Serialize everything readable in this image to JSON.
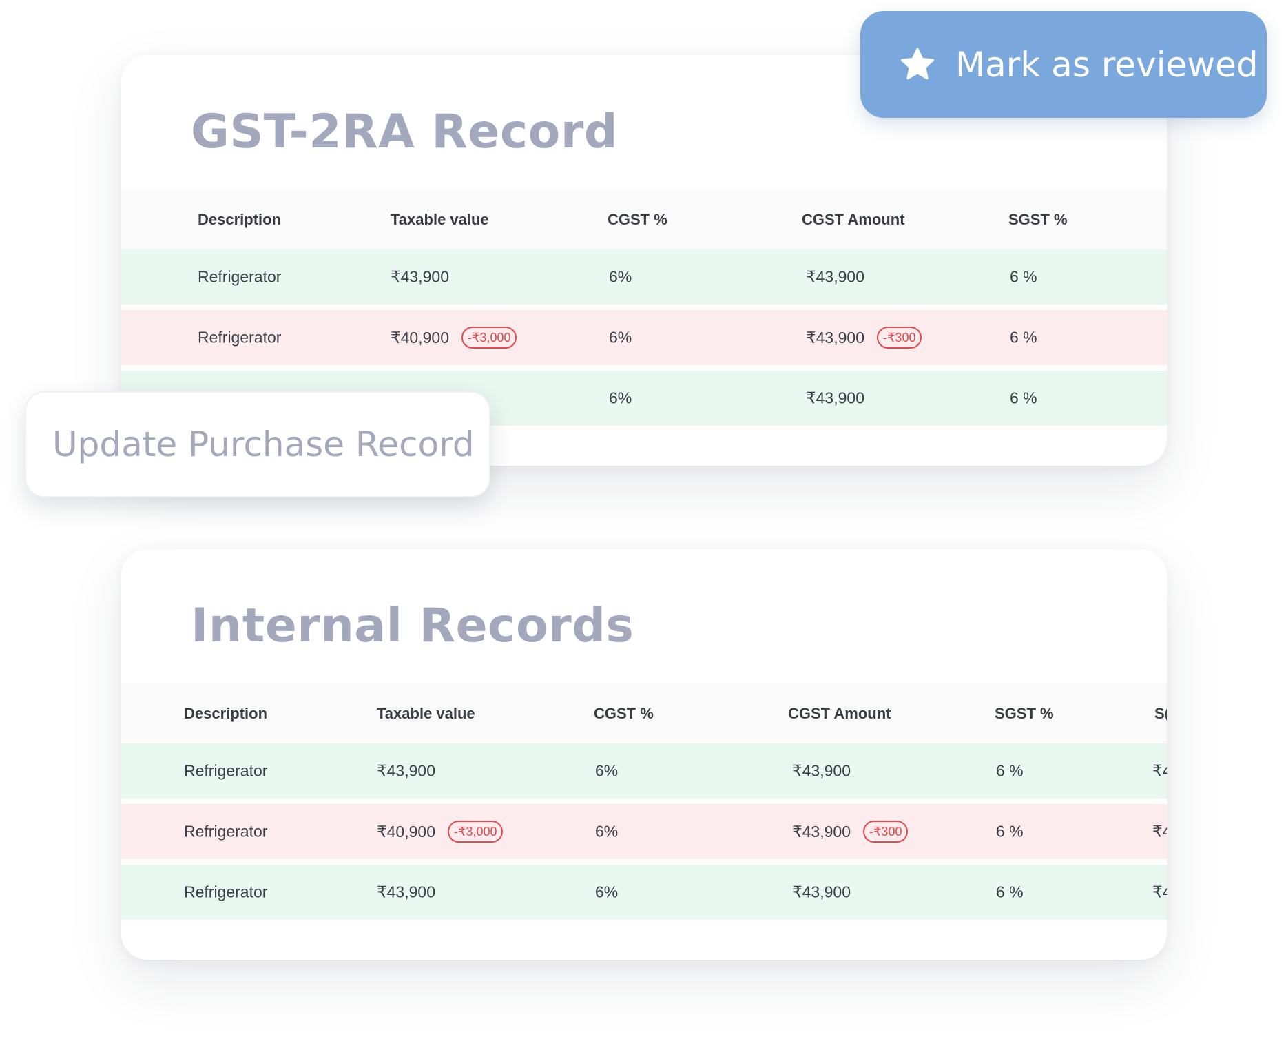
{
  "gst_card": {
    "title": "GST-2RA Record",
    "headers": [
      "Description",
      "Taxable value",
      "CGST %",
      "CGST Amount",
      "SGST %"
    ],
    "rows": [
      {
        "status": "match",
        "description": "Refrigerator",
        "taxable_value": "₹43,900",
        "taxable_diff": "",
        "cgst_pct": "6%",
        "cgst_amount": "₹43,900",
        "cgst_diff": "",
        "sgst_pct": "6 %"
      },
      {
        "status": "mismatch",
        "description": "Refrigerator",
        "taxable_value": "₹40,900",
        "taxable_diff": "-₹3,000",
        "cgst_pct": "6%",
        "cgst_amount": "₹43,900",
        "cgst_diff": "-₹300",
        "sgst_pct": "6 %"
      },
      {
        "status": "match",
        "description": "",
        "taxable_value": "",
        "taxable_diff": "",
        "cgst_pct": "6%",
        "cgst_amount": "₹43,900",
        "cgst_diff": "",
        "sgst_pct": "6 %"
      }
    ]
  },
  "internal_card": {
    "title": "Internal Records",
    "headers": [
      "Description",
      "Taxable value",
      "CGST %",
      "CGST Amount",
      "SGST %",
      "S("
    ],
    "rows": [
      {
        "status": "match",
        "description": "Refrigerator",
        "taxable_value": "₹43,900",
        "taxable_diff": "",
        "cgst_pct": "6%",
        "cgst_amount": "₹43,900",
        "cgst_diff": "",
        "sgst_pct": "6 %",
        "sgst_amount": "₹4"
      },
      {
        "status": "mismatch",
        "description": "Refrigerator",
        "taxable_value": "₹40,900",
        "taxable_diff": "-₹3,000",
        "cgst_pct": "6%",
        "cgst_amount": "₹43,900",
        "cgst_diff": "-₹300",
        "sgst_pct": "6 %",
        "sgst_amount": "₹4"
      },
      {
        "status": "match",
        "description": "Refrigerator",
        "taxable_value": "₹43,900",
        "taxable_diff": "",
        "cgst_pct": "6%",
        "cgst_amount": "₹43,900",
        "cgst_diff": "",
        "sgst_pct": "6 %",
        "sgst_amount": "₹4"
      }
    ]
  },
  "actions": {
    "review_label": "Mark as reviewed",
    "review_icon": "star-icon",
    "update_label": "Update Purchase Record"
  },
  "colors": {
    "match_row": "#e8f7ef",
    "mismatch_row": "#fdeced",
    "diff_badge": "#e5484d",
    "review_button": "#7aa8dc",
    "title": "#a3a8bd"
  }
}
